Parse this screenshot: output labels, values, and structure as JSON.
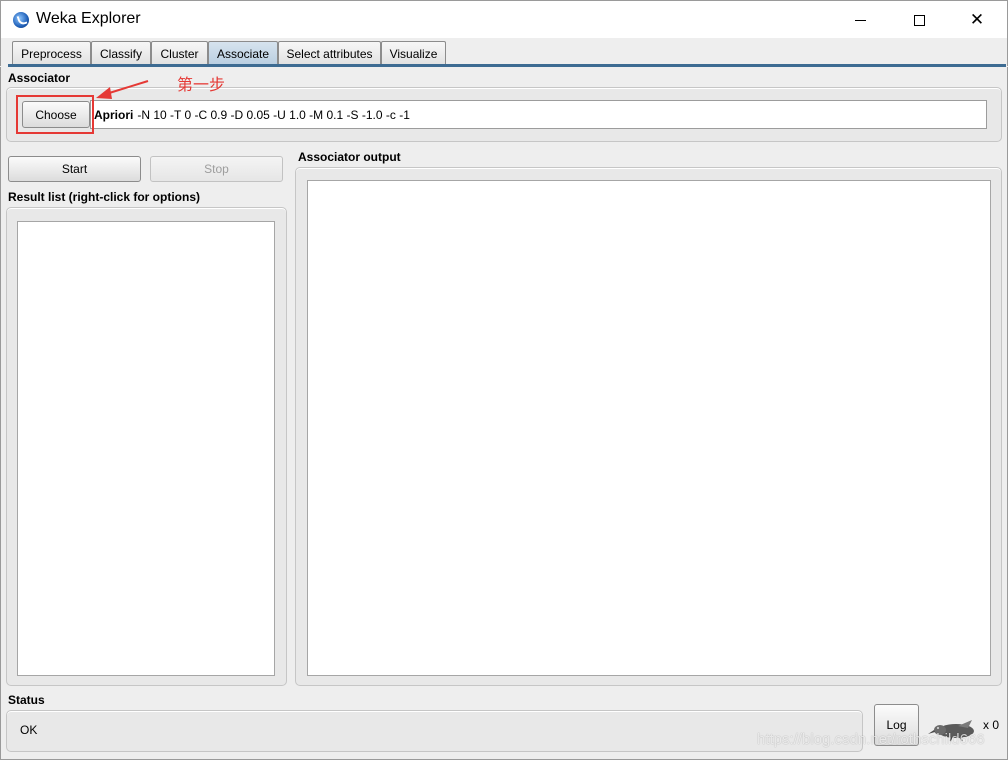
{
  "window": {
    "title": "Weka Explorer",
    "icon": "weka-logo-icon",
    "controls": {
      "minimize": "minimize-icon",
      "maximize": "maximize-icon",
      "close": "✕"
    }
  },
  "tabs": [
    {
      "label": "Preprocess",
      "selected": false
    },
    {
      "label": "Classify",
      "selected": false
    },
    {
      "label": "Cluster",
      "selected": false
    },
    {
      "label": "Associate",
      "selected": true
    },
    {
      "label": "Select attributes",
      "selected": false
    },
    {
      "label": "Visualize",
      "selected": false
    }
  ],
  "associator": {
    "section_label": "Associator",
    "choose_label": "Choose",
    "algorithm_name": "Apriori",
    "algorithm_options": "-N 10 -T 0 -C 0.9 -D 0.05 -U 1.0 -M 0.1 -S -1.0 -c -1"
  },
  "annotation": {
    "text": "第一步",
    "color": "#e53935"
  },
  "controls": {
    "start_label": "Start",
    "stop_label": "Stop",
    "stop_enabled": false
  },
  "result_list": {
    "label": "Result list (right-click for options)",
    "items": []
  },
  "output": {
    "label": "Associator output",
    "text": ""
  },
  "status": {
    "label": "Status",
    "message": "OK",
    "log_label": "Log",
    "task_count": "x 0",
    "status_icon": "weka-bird-icon"
  },
  "watermark": "https://blog.csdn.net/rothschild666",
  "colors": {
    "selected_tab": "#b8cde0",
    "tab_underline": "#3d6b92",
    "annotation": "#e53935"
  }
}
